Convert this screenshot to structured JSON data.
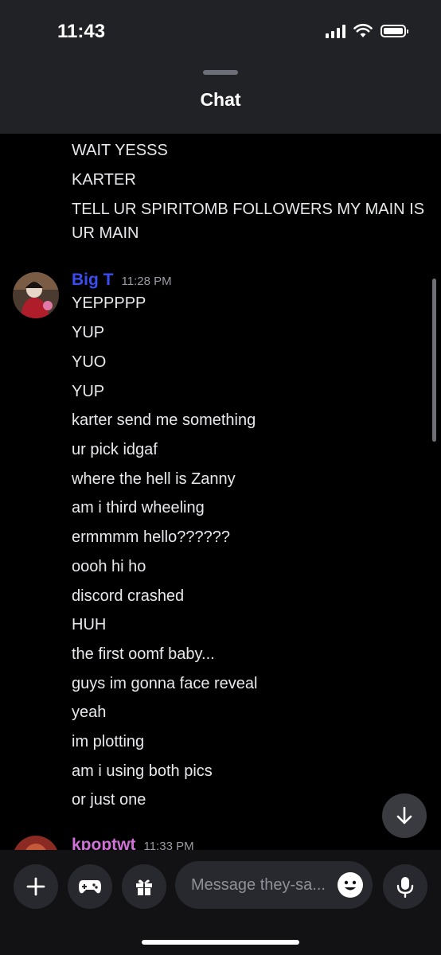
{
  "status_bar": {
    "time": "11:43"
  },
  "header": {
    "title": "Chat"
  },
  "continued_messages": [
    "WAIT YESSS",
    "KARTER",
    "TELL UR SPIRITOMB FOLLOWERS MY MAIN IS",
    "UR MAIN"
  ],
  "group_big_t": {
    "author": "Big T",
    "author_color": "#3b4cf2",
    "timestamp": "11:28 PM",
    "messages": [
      "YEPPPPP",
      "YUP",
      "YUO",
      "YUP",
      "karter send me something",
      "ur pick idgaf",
      "where the hell is Zanny",
      "am i third wheeling",
      "ermmmm hello??????",
      "oooh hi ho",
      "discord crashed",
      "HUH",
      "the first oomf baby...",
      "guys im gonna face reveal",
      "yeah",
      "im plotting",
      "am i using both pics",
      "or just one"
    ]
  },
  "group_next": {
    "author": "kpoptwt",
    "author_color": "#d071d8",
    "timestamp": "11:33 PM"
  },
  "composer": {
    "placeholder": "Message they-sa..."
  },
  "icons": {
    "add": "plus-icon",
    "games": "gamepad-icon",
    "gift": "gift-icon",
    "emoji": "emoji-icon",
    "voice": "microphone-icon",
    "jump": "arrow-down-icon"
  }
}
